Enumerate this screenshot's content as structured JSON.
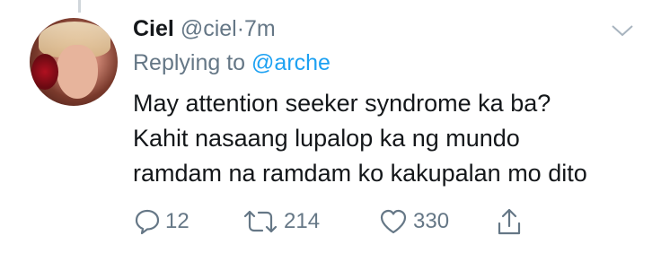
{
  "tweet": {
    "display_name": "Ciel",
    "handle": "@ciel",
    "separator": "·",
    "time": "7m",
    "replying_prefix": "Replying to ",
    "replying_to": "@arche",
    "text_lines": [
      "May attention seeker syndrome ka ba?",
      "Kahit nasaang lupalop ka ng mundo",
      "ramdam na ramdam ko kakupalan mo dito"
    ],
    "counts": {
      "replies": "12",
      "retweets": "214",
      "likes": "330"
    }
  },
  "icons": {
    "menu": "chevron-down-icon",
    "reply": "reply-bubble-icon",
    "retweet": "retweet-icon",
    "like": "heart-icon",
    "share": "share-icon"
  },
  "colors": {
    "text": "#14171a",
    "secondary": "#657786",
    "link": "#1da1f2"
  }
}
